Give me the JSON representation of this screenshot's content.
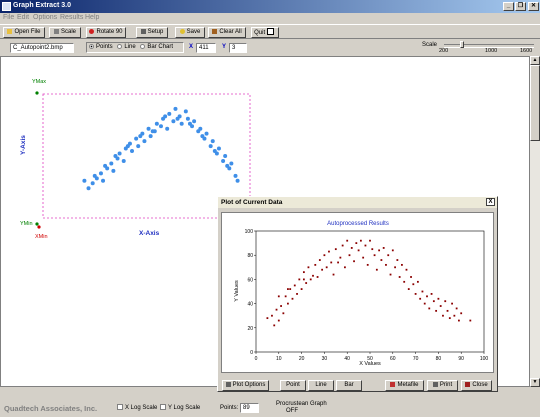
{
  "window": {
    "title": "Graph Extract 3.0",
    "minimize": "_",
    "restore": "❐",
    "close": "✕"
  },
  "menu": [
    "File",
    "Edit",
    "Options",
    "Results",
    "Help"
  ],
  "toolbar": {
    "open_file": "Open File",
    "scale": "Scale",
    "rotate": "Rotate 90",
    "setup": "Setup",
    "save": "Save",
    "clear_all": "Clear All",
    "quit": "Quit"
  },
  "options": {
    "file_name": "C_Autopoint2.bmp",
    "plot_modes": [
      "Points",
      "Line",
      "Bar Chart"
    ],
    "selected_mode": "Points",
    "x_label": "X",
    "x_value": "411",
    "y_label": "Y",
    "y_value": "3",
    "scale_label": "Scale",
    "scale_ticks": [
      "200",
      "1000",
      "1600"
    ]
  },
  "image": {
    "ymax_label": "YMax",
    "ymin_label": "YMin",
    "xmin_label": "XMin",
    "y_axis_label": "Y-Axis",
    "x_axis_label": "X-Axis",
    "colors": {
      "points": "#3f8fe8",
      "frame": "#e040c0",
      "axis_label": "#2030c0"
    }
  },
  "status": {
    "company": "Quadtech Associates, Inc.",
    "x_log": "X Log Scale",
    "y_log": "Y Log Scale",
    "points_label": "Points:",
    "points_value": "89",
    "procrustean": "Procrustean Graph",
    "procrustean_state": "OFF"
  },
  "plot_window": {
    "title": "Plot of Current Data",
    "close": "X",
    "buttons": {
      "plot_options": "Plot Options",
      "point": "Point",
      "line": "Line",
      "bar": "Bar",
      "metafile": "Metafile",
      "print": "Print",
      "close": "Close"
    }
  },
  "chart_data": {
    "type": "scatter",
    "title": "Autoprocessed Results",
    "xlabel": "X Values",
    "ylabel": "Y Values",
    "xlim": [
      0,
      100
    ],
    "ylim": [
      0,
      100
    ],
    "xticks": [
      0,
      10,
      20,
      30,
      40,
      50,
      60,
      70,
      80,
      90,
      100
    ],
    "yticks": [
      0,
      20,
      40,
      60,
      80,
      100
    ],
    "marker_color": "#8b0000",
    "title_color": "#2030c0",
    "grid": false,
    "x": [
      5,
      7,
      8,
      9,
      10,
      11,
      12,
      13,
      14,
      15,
      16,
      17,
      18,
      19,
      20,
      21,
      22,
      23,
      24,
      25,
      26,
      27,
      28,
      29,
      30,
      31,
      32,
      33,
      34,
      35,
      36,
      37,
      38,
      39,
      40,
      41,
      42,
      43,
      44,
      45,
      46,
      47,
      48,
      49,
      50,
      51,
      52,
      53,
      54,
      55,
      56,
      57,
      58,
      59,
      60,
      61,
      62,
      63,
      64,
      65,
      66,
      67,
      68,
      69,
      70,
      71,
      72,
      73,
      74,
      75,
      76,
      77,
      78,
      79,
      80,
      81,
      82,
      83,
      84,
      85,
      86,
      87,
      88,
      89,
      90,
      94,
      10,
      14,
      21
    ],
    "y": [
      28,
      30,
      22,
      35,
      26,
      38,
      32,
      46,
      40,
      52,
      44,
      55,
      48,
      60,
      52,
      66,
      57,
      70,
      60,
      63,
      72,
      62,
      76,
      68,
      80,
      70,
      83,
      74,
      64,
      85,
      74,
      78,
      88,
      70,
      92,
      80,
      86,
      75,
      90,
      84,
      92,
      78,
      88,
      72,
      92,
      85,
      80,
      68,
      84,
      76,
      86,
      72,
      80,
      64,
      84,
      70,
      76,
      62,
      72,
      58,
      68,
      52,
      62,
      56,
      48,
      58,
      44,
      50,
      40,
      46,
      36,
      48,
      42,
      34,
      44,
      38,
      30,
      42,
      34,
      28,
      40,
      30,
      36,
      26,
      32,
      26,
      46,
      52,
      60
    ]
  },
  "source_points": {
    "x": [
      22,
      24,
      26,
      28,
      29,
      31,
      33,
      34,
      36,
      37,
      39,
      40,
      42,
      43,
      45,
      46,
      48,
      49,
      51,
      52,
      54,
      55,
      57,
      58,
      60,
      61,
      63,
      64,
      66,
      67,
      69,
      70,
      72,
      73,
      75,
      76,
      78,
      79,
      81,
      82,
      84,
      85,
      87,
      88,
      90,
      91,
      93,
      94,
      20,
      25,
      30,
      35,
      41,
      47,
      53,
      59,
      65,
      71,
      77,
      83,
      89
    ],
    "y": [
      24,
      28,
      32,
      36,
      30,
      40,
      44,
      38,
      48,
      52,
      46,
      56,
      60,
      54,
      64,
      58,
      68,
      62,
      72,
      66,
      70,
      76,
      74,
      80,
      72,
      84,
      78,
      88,
      82,
      76,
      86,
      80,
      74,
      78,
      70,
      72,
      64,
      68,
      58,
      62,
      52,
      56,
      46,
      50,
      40,
      44,
      34,
      30,
      30,
      34,
      42,
      50,
      58,
      66,
      70,
      82,
      80,
      76,
      66,
      54,
      42
    ]
  }
}
